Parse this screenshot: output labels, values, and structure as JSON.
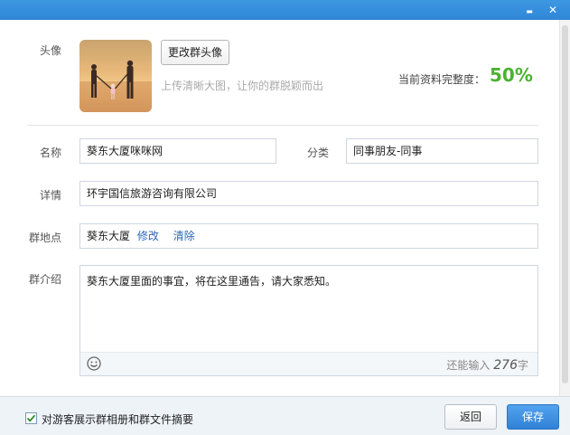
{
  "window": {
    "minimize_glyph": "▬",
    "close_glyph": "✕"
  },
  "avatar_section": {
    "label": "头像",
    "change_button": "更改群头像",
    "hint": "上传清晰大图，让你的群脱颖而出",
    "completeness_label": "当前资料完整度：",
    "completeness_value": "50%",
    "completeness_color": "#4cb132"
  },
  "form": {
    "name_label": "名称",
    "name_value": "葵东大厦咪咪网",
    "category_label": "分类",
    "category_value": "同事朋友-同事",
    "detail_label": "详情",
    "detail_value": "环宇国信旅游咨询有限公司",
    "location_label": "群地点",
    "location_value": "葵东大厦",
    "location_edit": "修改",
    "location_clear": "清除",
    "intro_label": "群介绍",
    "intro_value": "葵东大厦里面的事宜，将在这里通告，请大家悉知。",
    "remaining_prefix": "还能输入",
    "remaining_count": "276",
    "remaining_suffix": "字",
    "emoji_icon": "smiley-icon"
  },
  "footer": {
    "checkbox_label": "对游客展示群相册和群文件摘要",
    "checkbox_checked": true,
    "back_button": "返回",
    "save_button": "保存",
    "accent_color": "#3b8de0"
  }
}
